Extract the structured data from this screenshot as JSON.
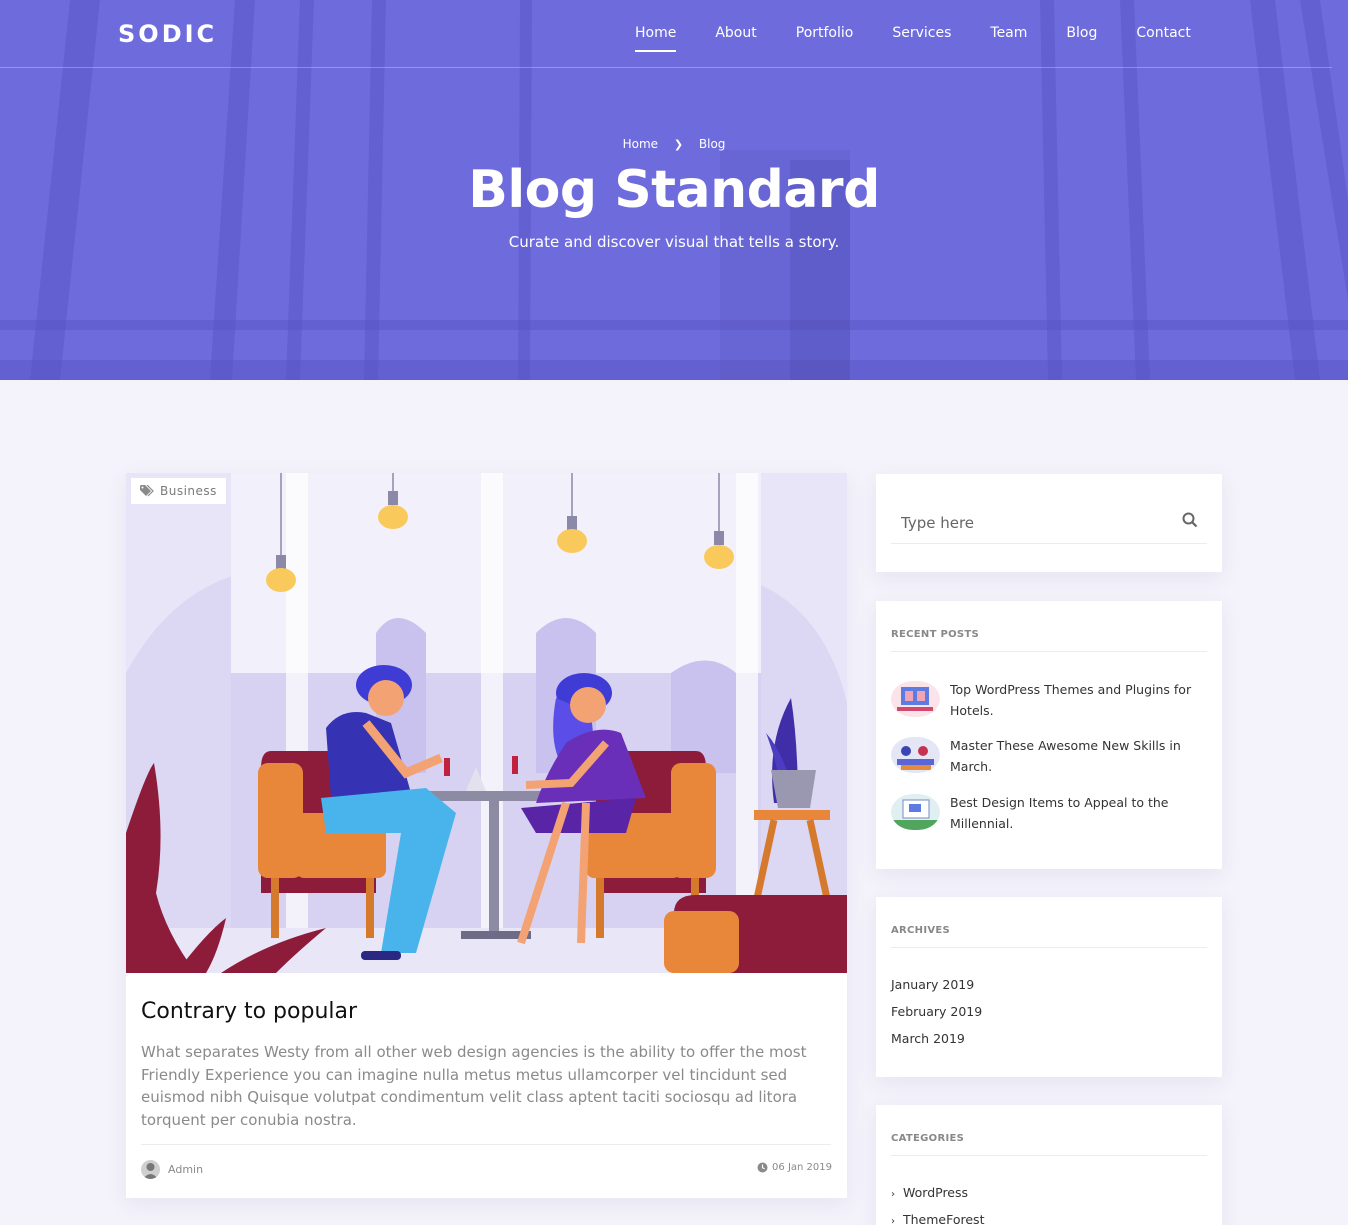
{
  "brand": {
    "logo": "SODIC"
  },
  "nav": {
    "items": [
      {
        "label": "Home",
        "active": true
      },
      {
        "label": "About"
      },
      {
        "label": "Portfolio"
      },
      {
        "label": "Services"
      },
      {
        "label": "Team"
      },
      {
        "label": "Blog"
      },
      {
        "label": "Contact"
      }
    ]
  },
  "hero": {
    "breadcrumb": [
      "Home",
      "Blog"
    ],
    "title": "Blog Standard",
    "subtitle": "Curate and discover visual that tells a story.",
    "overlay_color": "#6d6bdc"
  },
  "post": {
    "tag": "Business",
    "title": "Contrary to popular",
    "excerpt": "What separates Westy from all other web design agencies is the ability to offer the most Friendly Experience you can imagine nulla metus metus ullamcorper vel tincidunt sed euismod nibh Quisque volutpat condimentum velit class aptent taciti sociosqu ad litora torquent per conubia nostra.",
    "author": "Admin",
    "date": "06 Jan 2019"
  },
  "sidebar": {
    "search": {
      "placeholder": "Type here"
    },
    "recent_posts": {
      "title": "RECENT POSTS",
      "items": [
        {
          "title": "Top WordPress Themes and Plugins for Hotels."
        },
        {
          "title": "Master These Awesome New Skills in March."
        },
        {
          "title": "Best Design Items to Appeal to the Millennial."
        }
      ]
    },
    "archives": {
      "title": "ARCHIVES",
      "items": [
        "January 2019",
        "February 2019",
        "March 2019"
      ]
    },
    "categories": {
      "title": "CATEGORIES",
      "items": [
        "WordPress",
        "ThemeForest"
      ]
    }
  }
}
